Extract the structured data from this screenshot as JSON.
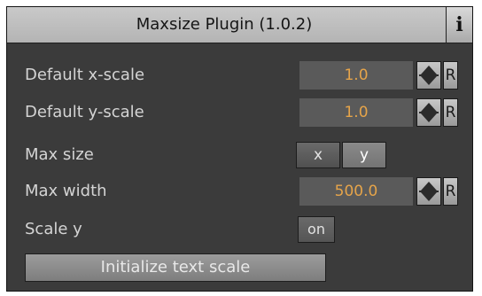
{
  "title": "Maxsize Plugin (1.0.2)",
  "info_button": "i",
  "rows": {
    "default_x_scale": {
      "label": "Default x-scale",
      "value": "1.0",
      "reset": "R"
    },
    "default_y_scale": {
      "label": "Default y-scale",
      "value": "1.0",
      "reset": "R"
    },
    "max_size": {
      "label": "Max size",
      "options": [
        "x",
        "y"
      ],
      "selected": "y"
    },
    "max_width": {
      "label": "Max width",
      "value": "500.0",
      "reset": "R"
    },
    "scale_y": {
      "label": "Scale y",
      "toggle": "on"
    }
  },
  "init_button": "Initialize text scale",
  "colors": {
    "panel_bg": "#3b3b3b",
    "value_text": "#e5a44a",
    "label_text": "#d4d4d4",
    "titlebar_bg": "#c0c0c0"
  },
  "icons": {
    "spinner": "up-down-arrows-icon"
  }
}
